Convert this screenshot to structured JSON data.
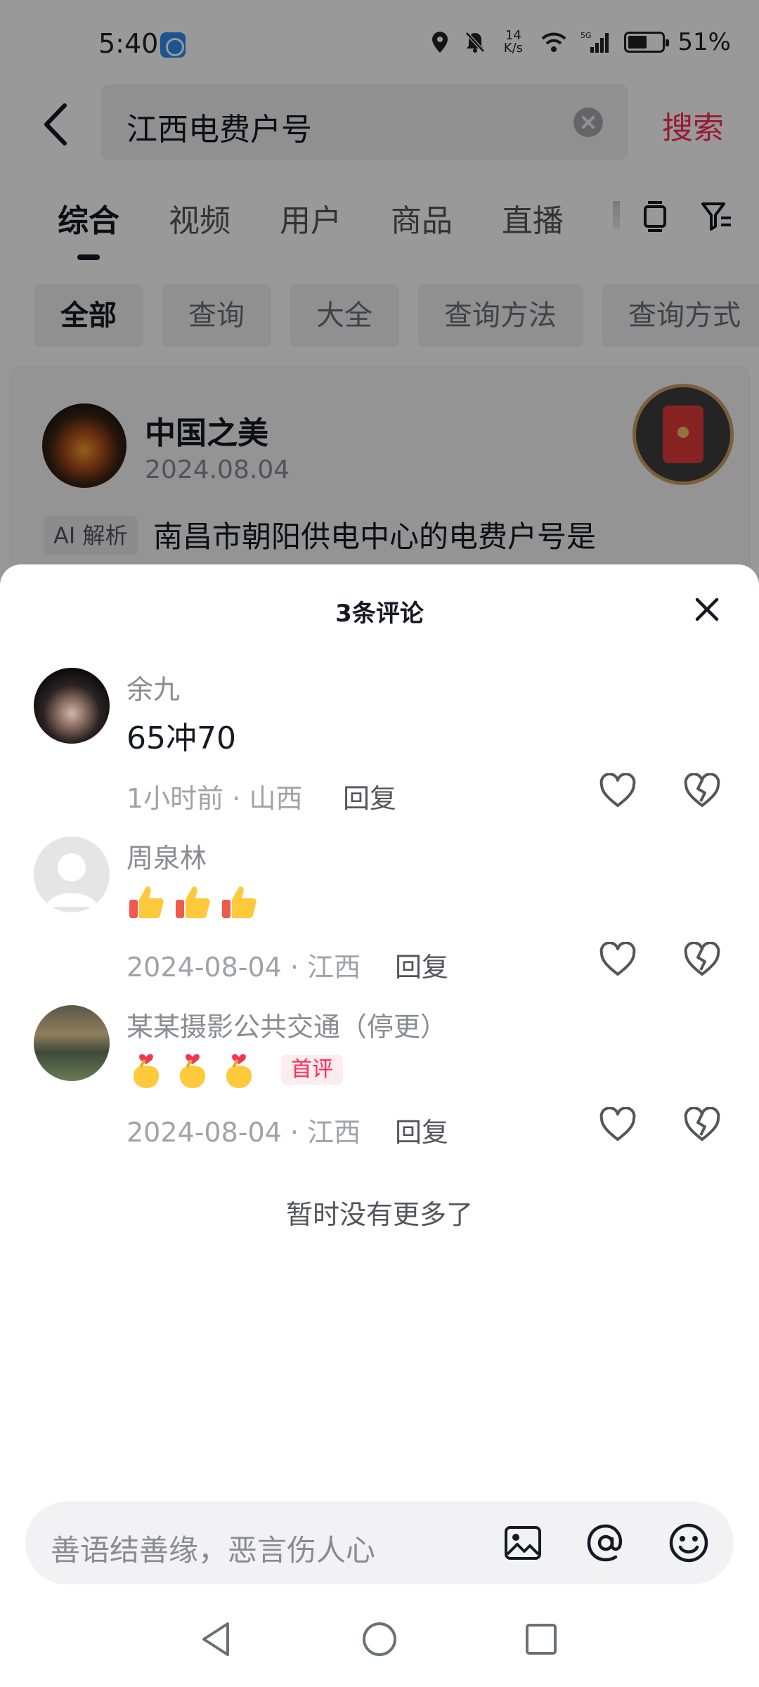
{
  "status_bar": {
    "time": "5:40",
    "net_speed_value": "14",
    "net_speed_unit": "K/s",
    "network": "5G",
    "battery": "51%"
  },
  "search": {
    "query": "江西电费户号",
    "submit_label": "搜索"
  },
  "tabs": [
    "综合",
    "视频",
    "用户",
    "商品",
    "直播"
  ],
  "active_tab": "综合",
  "chips": [
    "全部",
    "查询",
    "大全",
    "查询方法",
    "查询方式"
  ],
  "result_card": {
    "author": "中国之美",
    "date": "2024.08.04",
    "ai_badge": "AI 解析",
    "summary": "南昌市朝阳供电中心的电费户号是"
  },
  "comments_sheet": {
    "title": "3条评论",
    "reply_label": "回复",
    "comments": [
      {
        "name": "余九",
        "text": "65冲70",
        "time": "1小时前",
        "location": "山西"
      },
      {
        "name": "周泉林",
        "emojis": [
          "thumbs-up",
          "thumbs-up",
          "thumbs-up"
        ],
        "time": "2024-08-04",
        "location": "江西"
      },
      {
        "name": "某某摄影公共交通（停更）",
        "emojis": [
          "finger-heart",
          "finger-heart",
          "finger-heart"
        ],
        "badge": "首评",
        "time": "2024-08-04",
        "location": "江西"
      }
    ],
    "no_more": "暂时没有更多了"
  },
  "comment_input": {
    "placeholder": "善语结善缘，恶言伤人心"
  },
  "colors": {
    "accent": "#fe2c55",
    "text_primary": "#161823",
    "text_secondary": "#8a8b91"
  }
}
